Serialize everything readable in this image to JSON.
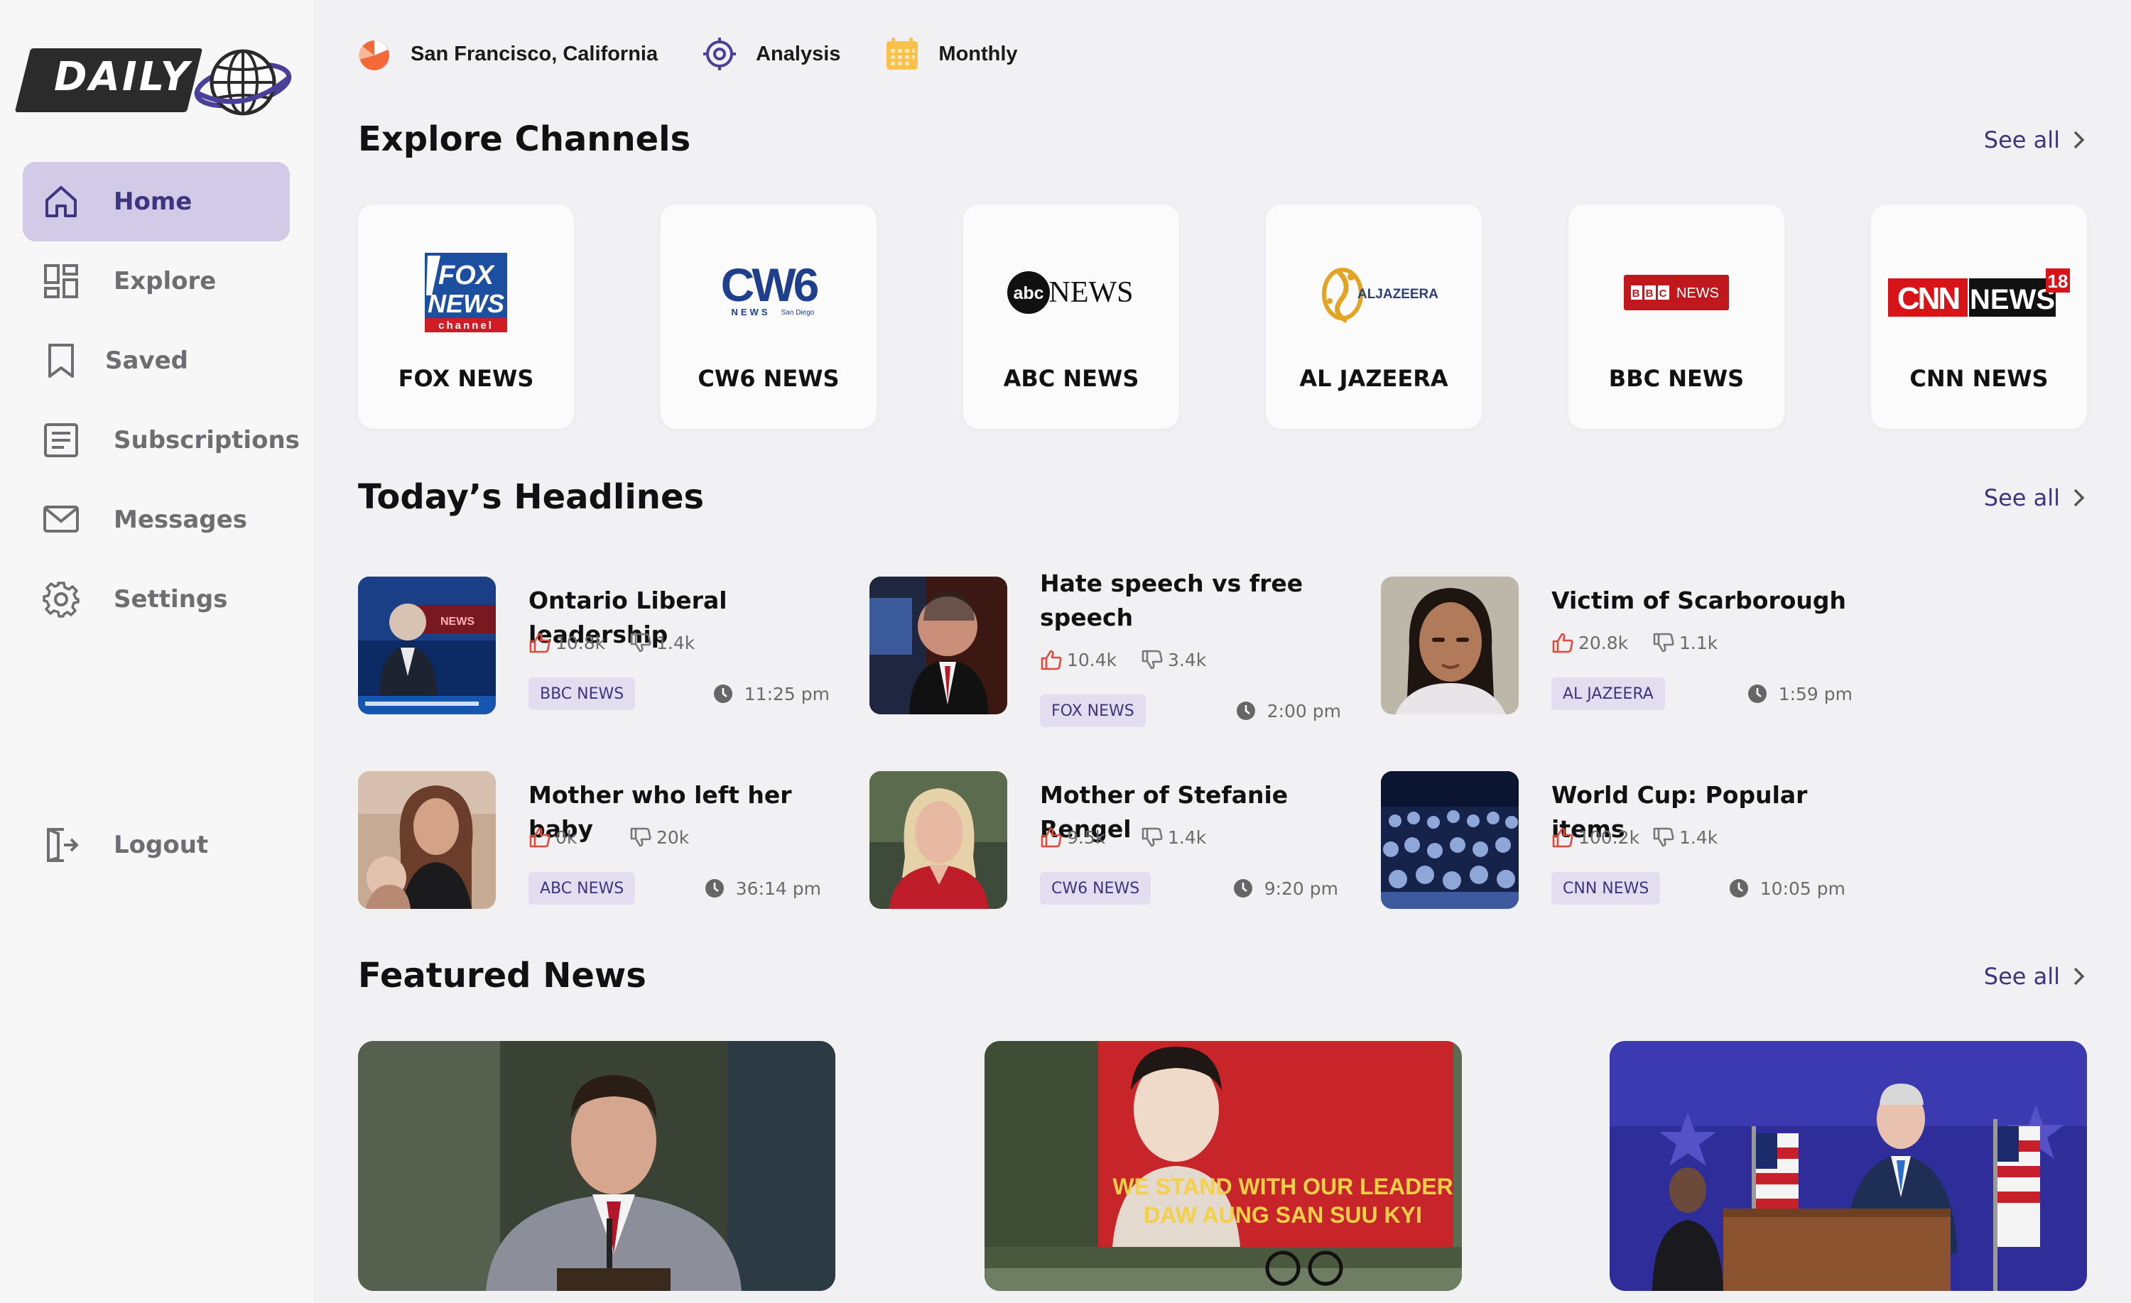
{
  "brand": {
    "logo_text": "DAILY"
  },
  "sidebar": {
    "items": [
      {
        "label": "Home",
        "icon": "home-icon",
        "active": true
      },
      {
        "label": "Explore",
        "icon": "grid-icon",
        "active": false
      },
      {
        "label": "Saved",
        "icon": "bookmark-icon",
        "active": false
      },
      {
        "label": "Subscriptions",
        "icon": "list-icon",
        "active": false
      },
      {
        "label": "Messages",
        "icon": "mail-icon",
        "active": false
      },
      {
        "label": "Settings",
        "icon": "gear-icon",
        "active": false
      }
    ],
    "logout_label": "Logout"
  },
  "topbar": {
    "location": "San Francisco, California",
    "analysis": "Analysis",
    "period": "Monthly"
  },
  "sections": {
    "channels_title": "Explore Channels",
    "headlines_title": "Today’s Headlines",
    "featured_title": "Featured News",
    "see_all": "See all"
  },
  "channels": [
    {
      "name": "FOX NEWS",
      "logo": "fox-news-logo"
    },
    {
      "name": "CW6 NEWS",
      "logo": "cw6-news-logo"
    },
    {
      "name": "ABC NEWS",
      "logo": "abc-news-logo"
    },
    {
      "name": "AL JAZEERA",
      "logo": "al-jazeera-logo"
    },
    {
      "name": "BBC NEWS",
      "logo": "bbc-news-logo"
    },
    {
      "name": "CNN NEWS",
      "logo": "cnn-news18-logo"
    }
  ],
  "headlines": [
    {
      "title": "Ontario Liberal leadership",
      "likes": "10.8k",
      "dislikes": "1.4k",
      "source": "BBC NEWS",
      "time": "11:25 pm"
    },
    {
      "title": "Hate speech vs free speech",
      "likes": "10.4k",
      "dislikes": "3.4k",
      "source": "FOX NEWS",
      "time": "2:00 pm"
    },
    {
      "title": "Victim of Scarborough",
      "likes": "20.8k",
      "dislikes": "1.1k",
      "source": "AL JAZEERA",
      "time": "1:59 pm"
    },
    {
      "title": "Mother who left her baby",
      "likes": "0k",
      "dislikes": "20k",
      "source": "ABC NEWS",
      "time": "36:14 pm"
    },
    {
      "title": "Mother of Stefanie Rengel",
      "likes": "9.5k",
      "dislikes": "1.4k",
      "source": "CW6 NEWS",
      "time": "9:20 pm"
    },
    {
      "title": "World Cup: Popular items",
      "likes": "100.2k",
      "dislikes": "1.4k",
      "source": "CNN NEWS",
      "time": "10:05 pm"
    }
  ],
  "featured": {
    "banner_text_line1": "WE STAND WITH OUR LEADER",
    "banner_text_line2": "DAW AUNG SAN SUU KYI"
  },
  "colors": {
    "accent": "#3d3580",
    "accent_light": "#d1cbe8",
    "tag_bg": "#e2deef",
    "like_red": "#e04a3a",
    "background": "#f1f0f3"
  }
}
